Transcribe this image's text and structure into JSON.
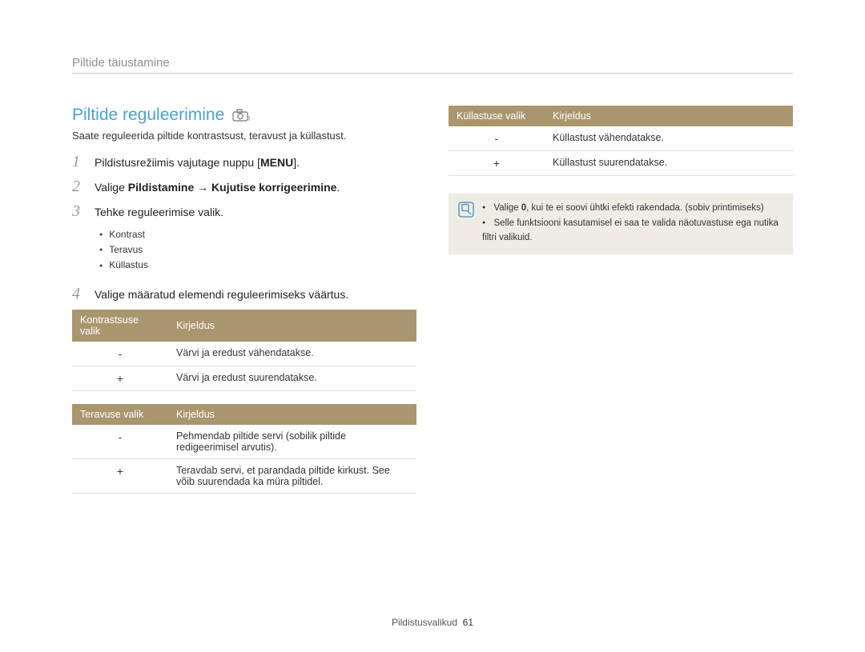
{
  "breadcrumb": "Piltide täiustamine",
  "section_title": "Piltide reguleerimine",
  "intro": "Saate reguleerida piltide kontrastsust, teravust ja küllastust.",
  "steps": {
    "s1_pre": "Pildistusrežiimis vajutage nuppu [",
    "s1_bold": "MENU",
    "s1_post": "].",
    "s2_pre": "Valige ",
    "s2_bold": "Pildistamine → Kujutise korrigeerimine",
    "s2_post": ".",
    "s3": "Tehke reguleerimise valik.",
    "s4": "Valige määratud elemendi reguleerimiseks väärtus."
  },
  "bullets": [
    "Kontrast",
    "Teravus",
    "Küllastus"
  ],
  "tables": {
    "contrast": {
      "h1": "Kontrastsuse valik",
      "h2": "Kirjeldus",
      "rows": [
        {
          "opt": "-",
          "desc": "Värvi ja eredust vähendatakse."
        },
        {
          "opt": "+",
          "desc": "Värvi ja eredust suurendatakse."
        }
      ]
    },
    "sharpness": {
      "h1": "Teravuse valik",
      "h2": "Kirjeldus",
      "rows": [
        {
          "opt": "-",
          "desc": "Pehmendab piltide servi (sobilik piltide redigeerimisel arvutis)."
        },
        {
          "opt": "+",
          "desc": "Teravdab servi, et parandada piltide kirkust. See võib suurendada ka müra piltidel."
        }
      ]
    },
    "saturation": {
      "h1": "Küllastuse valik",
      "h2": "Kirjeldus",
      "rows": [
        {
          "opt": "-",
          "desc": "Küllastust vähendatakse."
        },
        {
          "opt": "+",
          "desc": "Küllastust suurendatakse."
        }
      ]
    }
  },
  "note": {
    "items": [
      {
        "pre": "Valige ",
        "bold": "0",
        "post": ", kui te ei soovi ühtki efekti rakendada. (sobiv printimiseks)"
      },
      {
        "pre": "",
        "bold": "",
        "post": "Selle funktsiooni kasutamisel ei saa te valida näotuvastuse ega nutika filtri valikuid."
      }
    ]
  },
  "footer": {
    "label": "Pildistusvalikud",
    "page": "61"
  }
}
